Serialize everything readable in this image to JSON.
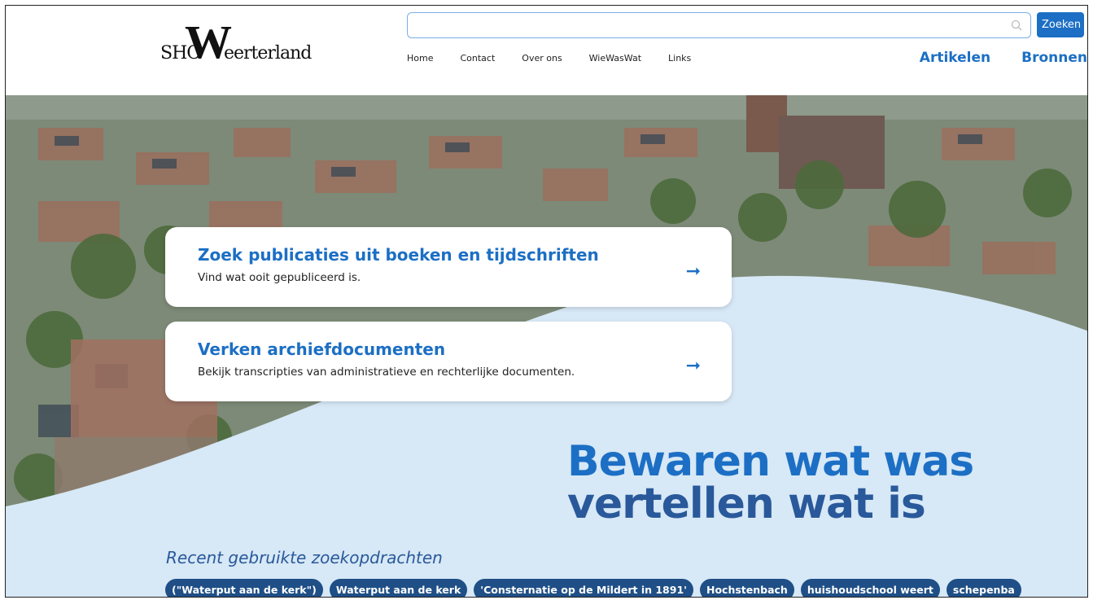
{
  "logo": {
    "prefix": "SHO",
    "letter": "W",
    "rest": "eerterland"
  },
  "search": {
    "placeholder": "",
    "button_label": "Zoeken"
  },
  "nav": {
    "items": [
      "Home",
      "Contact",
      "Over ons",
      "WieWasWat",
      "Links"
    ]
  },
  "main_nav": {
    "items": [
      "Artikelen",
      "Bronnen"
    ]
  },
  "cards": [
    {
      "title": "Zoek publicaties uit boeken en tijdschriften",
      "subtitle": "Vind wat ooit gepubliceerd is.",
      "arrow": "➞"
    },
    {
      "title": "Verken archiefdocumenten",
      "subtitle": "Bekijk transcripties van administratieve en rechterlijke documenten.",
      "arrow": "➞"
    }
  ],
  "tagline": {
    "line1": "Bewaren wat was",
    "line2": "vertellen wat is"
  },
  "recent": {
    "title": "Recent gebruikte zoekopdrachten",
    "chips": [
      "(\"Waterput aan de kerk\")",
      "Waterput aan de kerk",
      "'Consternatie op de Mildert in 1891'",
      "Hochstenbach",
      "huishoudschool weert",
      "schepenba"
    ]
  },
  "colors": {
    "accent": "#1c6fc4",
    "dark_blue": "#29599a",
    "chip_bg": "#1f4f86",
    "wave": "#d7e8f6"
  }
}
